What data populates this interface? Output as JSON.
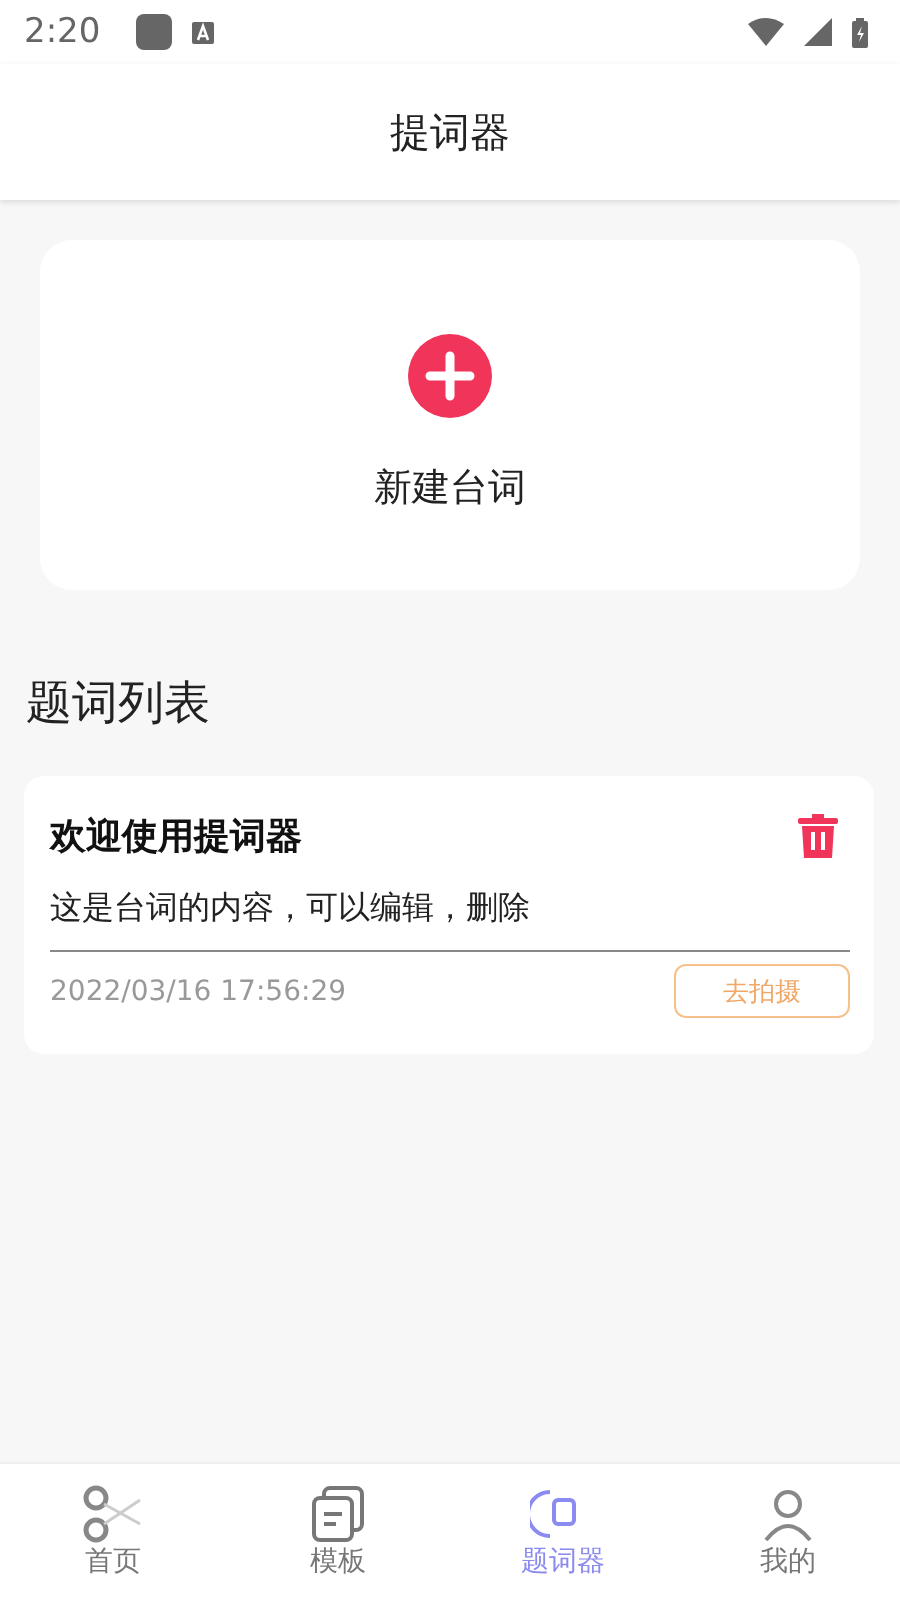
{
  "status_bar": {
    "time": "2:20"
  },
  "header": {
    "title": "提词器"
  },
  "new_card": {
    "label": "新建台词"
  },
  "section_title": "题词列表",
  "scripts": [
    {
      "title": "欢迎使用提词器",
      "content": "这是台词的内容，可以编辑，删除",
      "date": "2022/03/16 17:56:29",
      "action": "去拍摄"
    }
  ],
  "tabs": [
    {
      "label": "首页",
      "kind": "scissors",
      "selected": false
    },
    {
      "label": "模板",
      "kind": "template",
      "selected": false
    },
    {
      "label": "题词器",
      "kind": "prompter",
      "selected": true
    },
    {
      "label": "我的",
      "kind": "user",
      "selected": false
    }
  ]
}
